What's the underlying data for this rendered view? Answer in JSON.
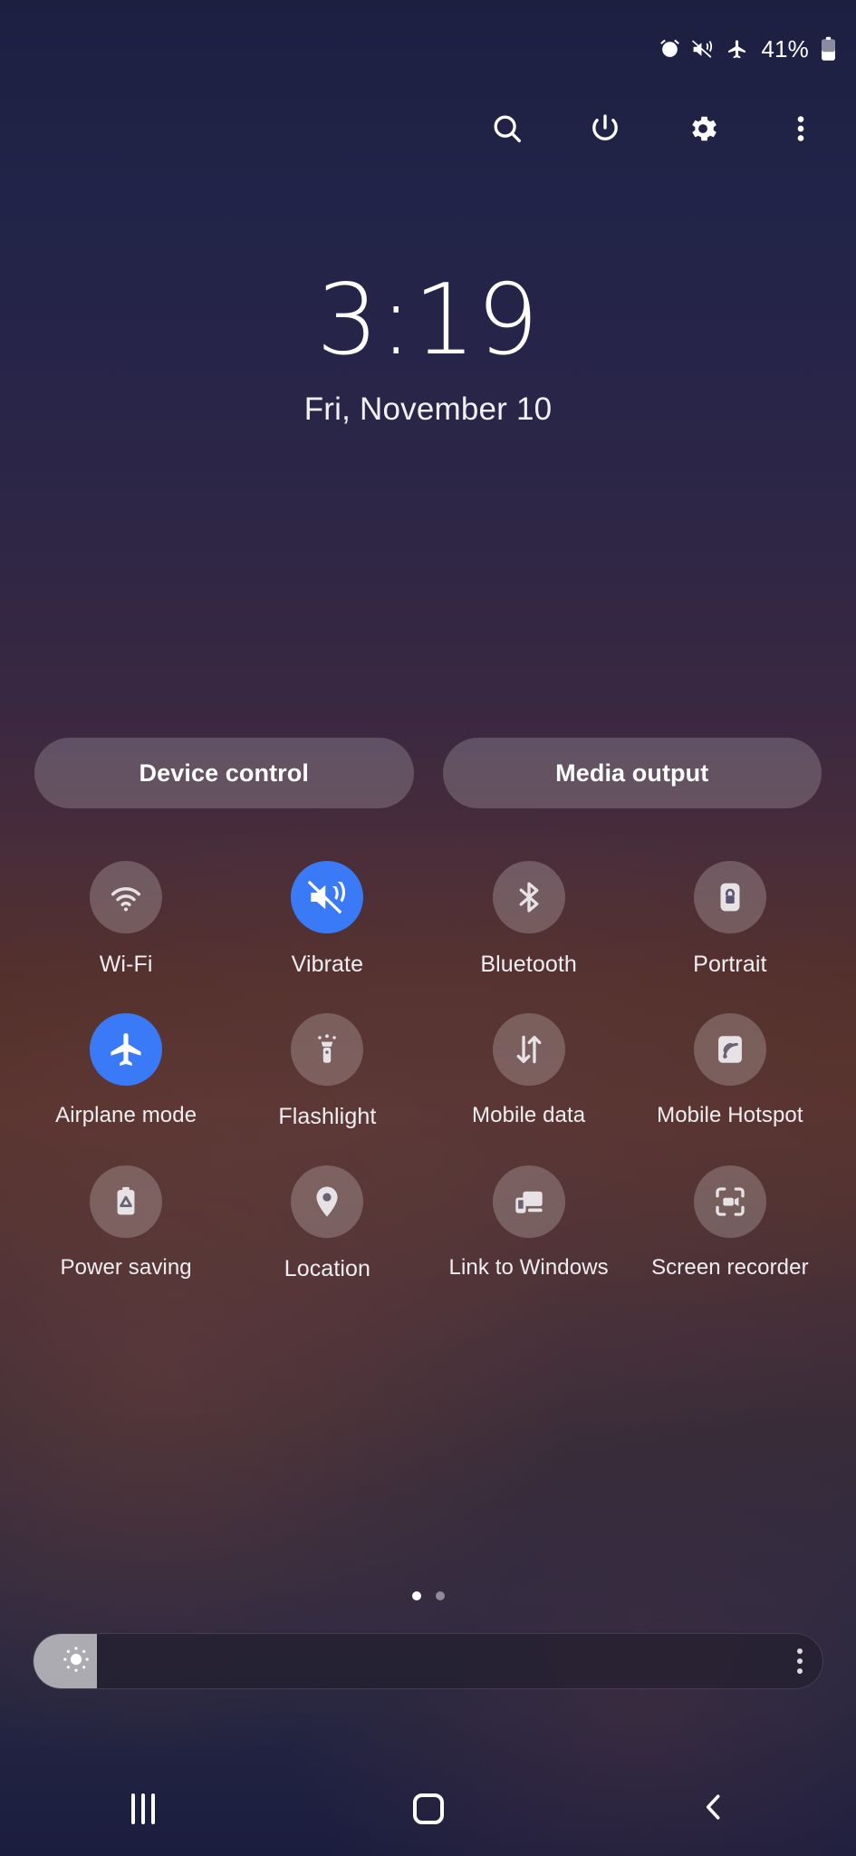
{
  "status_bar": {
    "icons": [
      "alarm-icon",
      "vibrate-icon",
      "airplane-icon"
    ],
    "battery_percent": "41%",
    "battery_icon": "battery-icon"
  },
  "action_row": {
    "items": [
      {
        "name": "search-icon",
        "label": "Search"
      },
      {
        "name": "power-icon",
        "label": "Power off"
      },
      {
        "name": "settings-icon",
        "label": "Settings"
      },
      {
        "name": "overflow-icon",
        "label": "More options"
      }
    ]
  },
  "clock": {
    "time": "3:19",
    "date": "Fri, November 10"
  },
  "pills": {
    "device_control": "Device control",
    "media_output": "Media output"
  },
  "quick_settings": {
    "rows": [
      [
        {
          "label": "Wi-Fi",
          "icon": "wifi-icon",
          "active": false
        },
        {
          "label": "Vibrate",
          "icon": "vibrate-icon",
          "active": true
        },
        {
          "label": "Bluetooth",
          "icon": "bluetooth-icon",
          "active": false
        },
        {
          "label": "Portrait",
          "icon": "rotation-lock-icon",
          "active": false
        }
      ],
      [
        {
          "label": "Airplane mode",
          "icon": "airplane-icon",
          "active": true
        },
        {
          "label": "Flashlight",
          "icon": "flashlight-icon",
          "active": false
        },
        {
          "label": "Mobile data",
          "icon": "mobile-data-icon",
          "active": false
        },
        {
          "label": "Mobile Hotspot",
          "icon": "hotspot-icon",
          "active": false
        }
      ],
      [
        {
          "label": "Power saving",
          "icon": "power-saving-icon",
          "active": false
        },
        {
          "label": "Location",
          "icon": "location-pin-icon",
          "active": false
        },
        {
          "label": "Link to Windows",
          "icon": "link-windows-icon",
          "active": false
        },
        {
          "label": "Screen recorder",
          "icon": "screen-recorder-icon",
          "active": false
        }
      ]
    ]
  },
  "pager": {
    "total": 2,
    "active_index": 0
  },
  "brightness": {
    "value_percent": 8,
    "icon": "brightness-sun-icon",
    "menu_icon": "overflow-icon"
  },
  "nav_bar": {
    "recents": "recents-button",
    "home": "home-button",
    "back": "back-button"
  },
  "colors": {
    "accent_active": "#3b7af7",
    "text_primary": "#ffffff",
    "tile_inactive": "rgba(255,255,255,0.21)"
  }
}
